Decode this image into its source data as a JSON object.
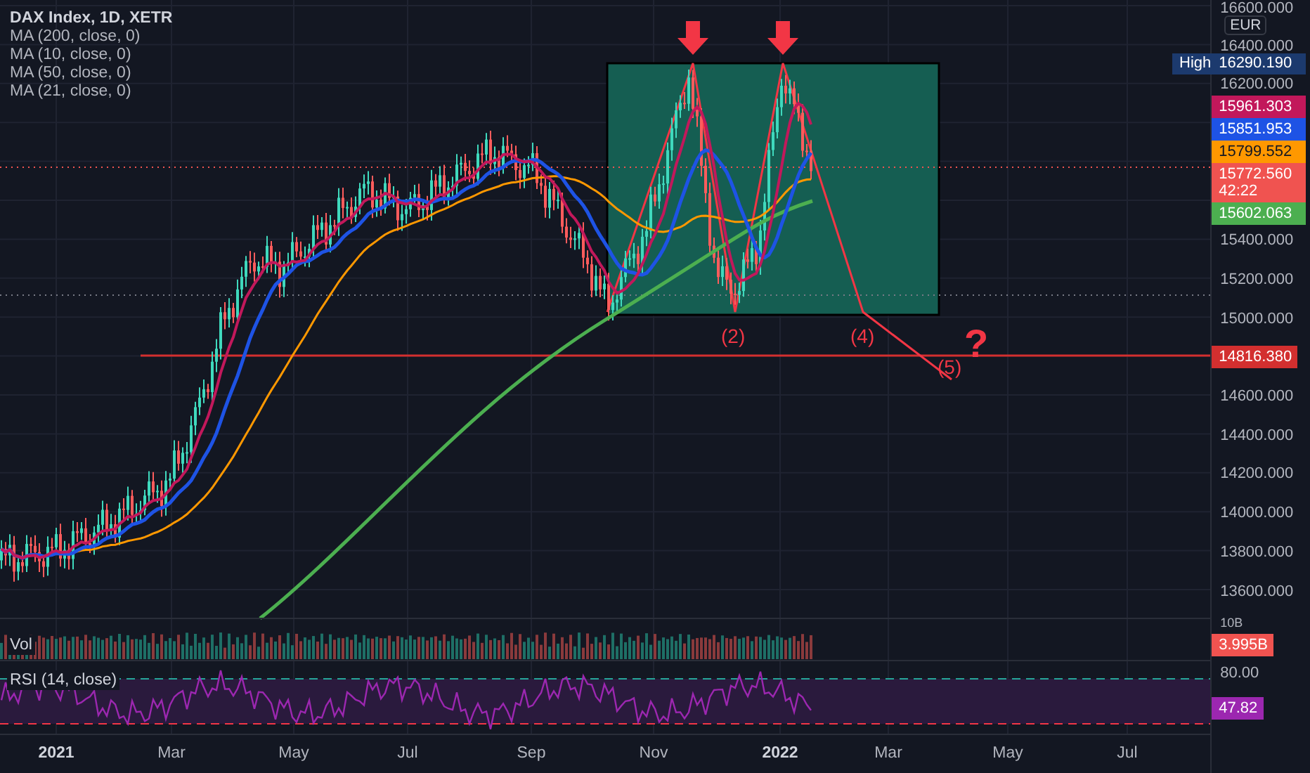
{
  "legend": {
    "title": "DAX Index, 1D, XETR",
    "indicators": [
      "MA (200, close, 0)",
      "MA (10, close, 0)",
      "MA (50, close, 0)",
      "MA (21, close, 0)"
    ]
  },
  "price_axis": {
    "currency": "EUR",
    "ticks": [
      "16600.000",
      "16400.000",
      "16200.000",
      "15400.000",
      "15200.000",
      "15000.000",
      "14600.000",
      "14400.000",
      "14200.000",
      "14000.000",
      "13800.000",
      "13600.000"
    ],
    "high": {
      "label": "High",
      "value": "16290.190"
    },
    "badges": [
      {
        "text": "15961.303",
        "color": "#c2185b"
      },
      {
        "text": "15851.953",
        "color": "#1e53e5"
      },
      {
        "text": "15799.552",
        "color": "#ff9800"
      },
      {
        "text": "15772.560",
        "subtext": "42:22",
        "color": "#f05350"
      },
      {
        "text": "15602.063",
        "color": "#4caf50"
      }
    ],
    "support_badge": {
      "text": "14816.380",
      "color": "#d32f2f"
    }
  },
  "annotations": {
    "wave_labels": [
      "(2)",
      "(4)",
      "(5)"
    ],
    "question_mark": "?"
  },
  "volume_pane": {
    "label": "Vol",
    "axis_tick": "10B",
    "badge": {
      "text": "3.995B",
      "color": "#f05350"
    }
  },
  "rsi_pane": {
    "label": "RSI (14, close)",
    "axis_tick": "80.00",
    "badge": {
      "text": "47.82",
      "color": "#9c27b0"
    }
  },
  "time_axis": [
    {
      "label": "2021",
      "kind": "year"
    },
    {
      "label": "Mar",
      "kind": "month"
    },
    {
      "label": "May",
      "kind": "month"
    },
    {
      "label": "Jul",
      "kind": "month"
    },
    {
      "label": "Sep",
      "kind": "month"
    },
    {
      "label": "Nov",
      "kind": "month"
    },
    {
      "label": "2022",
      "kind": "year"
    },
    {
      "label": "Mar",
      "kind": "month"
    },
    {
      "label": "May",
      "kind": "month"
    },
    {
      "label": "Jul",
      "kind": "month"
    }
  ]
}
